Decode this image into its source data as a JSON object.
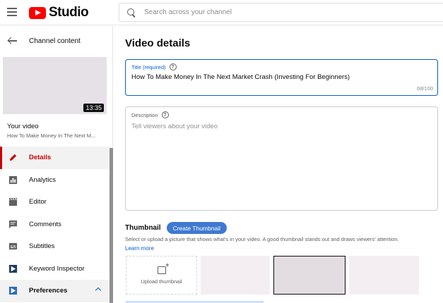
{
  "header": {
    "logo_text": "Studio",
    "search_placeholder": "Search across your channel"
  },
  "sidebar": {
    "title": "Channel content",
    "video_duration": "13:35",
    "your_video_label": "Your video",
    "video_title_short": "How To Make Money In The Next M...",
    "items": [
      {
        "label": "Details",
        "icon": "pencil-icon",
        "active": true
      },
      {
        "label": "Analytics",
        "icon": "analytics-icon"
      },
      {
        "label": "Editor",
        "icon": "clapperboard-icon"
      },
      {
        "label": "Comments",
        "icon": "comment-icon"
      },
      {
        "label": "Subtitles",
        "icon": "subtitles-icon"
      },
      {
        "label": "Keyword Inspector",
        "icon": "play-box-icon"
      },
      {
        "label": "Preferences",
        "icon": "play-box-icon"
      }
    ]
  },
  "main": {
    "page_title": "Video details",
    "title_field": {
      "label": "Title (required)",
      "value": "How To Make Money In The Next Market Crash (Investing For Beginners)",
      "count": "68/100"
    },
    "description_field": {
      "label": "Description",
      "placeholder": "Tell viewers about your video"
    },
    "thumbnail": {
      "heading": "Thumbnail",
      "create_button": "Create Thumbnail",
      "description": "Select or upload a picture that shows what's in your video. A good thumbnail stands out and draws viewers' attention.",
      "learn_more": "Learn more",
      "upload_label": "Upload thumbnail"
    }
  },
  "colors": {
    "accent_red": "#cc0000",
    "link_blue": "#065fd4",
    "button_blue": "#3f7ad1"
  }
}
